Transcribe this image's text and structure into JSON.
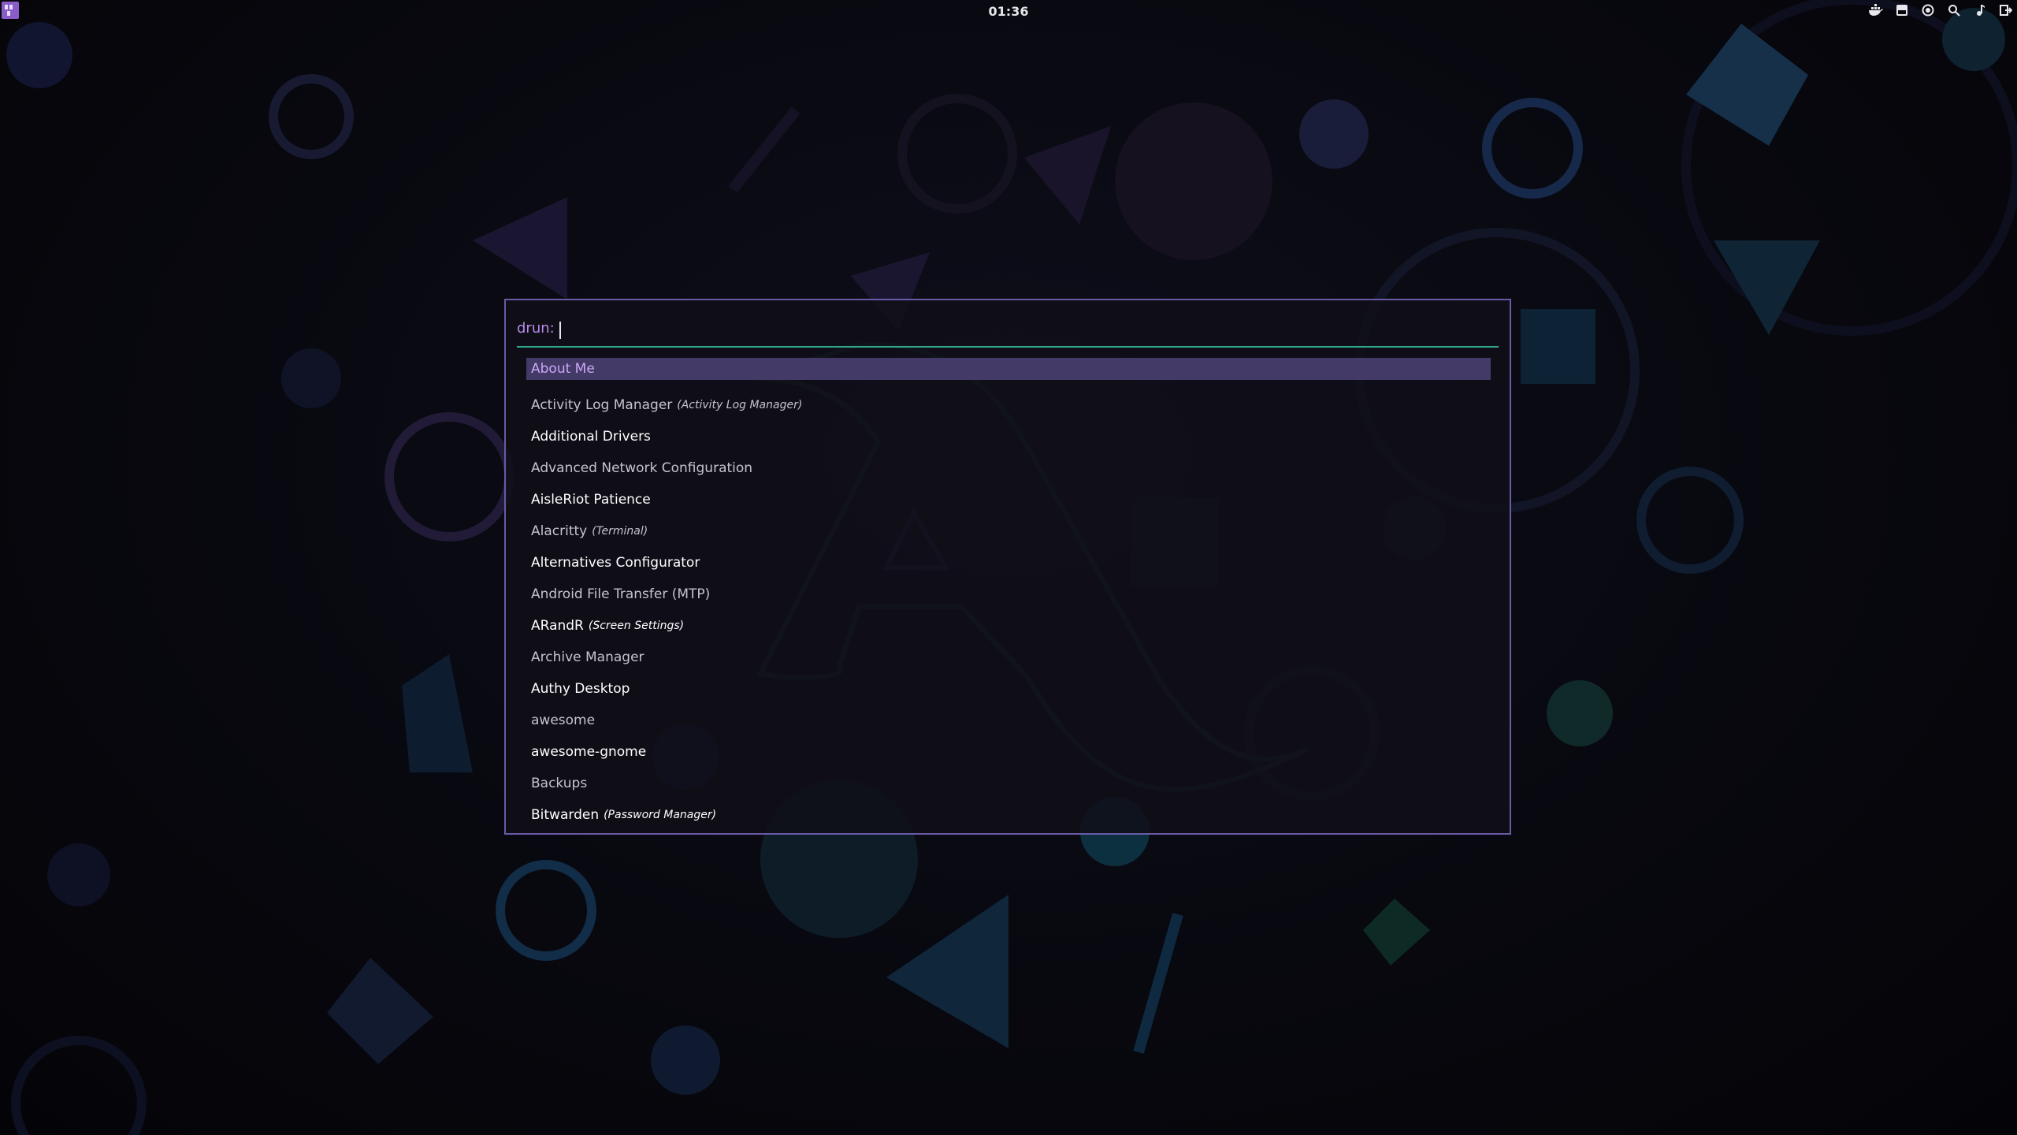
{
  "topbar": {
    "clock": "01:36",
    "launcher_icon": "app-launcher-icon",
    "tray_icons": [
      "docker-icon",
      "window-icon",
      "record-icon",
      "search-icon",
      "music-note-icon",
      "exit-icon"
    ]
  },
  "launcher": {
    "mode_prompt": "drun:",
    "search_value": "",
    "entries": [
      {
        "name": "About Me",
        "generic": "",
        "selected": true
      },
      {
        "name": "Activity Log Manager",
        "generic": "(Activity Log Manager)",
        "selected": false
      },
      {
        "name": "Additional Drivers",
        "generic": "",
        "selected": false
      },
      {
        "name": "Advanced Network Configuration",
        "generic": "",
        "selected": false
      },
      {
        "name": "AisleRiot Patience",
        "generic": "",
        "selected": false
      },
      {
        "name": "Alacritty",
        "generic": "(Terminal)",
        "selected": false
      },
      {
        "name": "Alternatives Configurator",
        "generic": "",
        "selected": false
      },
      {
        "name": "Android File Transfer (MTP)",
        "generic": "",
        "selected": false
      },
      {
        "name": "ARandR",
        "generic": "(Screen Settings)",
        "selected": false
      },
      {
        "name": "Archive Manager",
        "generic": "",
        "selected": false
      },
      {
        "name": "Authy Desktop",
        "generic": "",
        "selected": false
      },
      {
        "name": "awesome",
        "generic": "",
        "selected": false
      },
      {
        "name": "awesome-gnome",
        "generic": "",
        "selected": false
      },
      {
        "name": "Backups",
        "generic": "",
        "selected": false
      },
      {
        "name": "Bitwarden",
        "generic": "(Password Manager)",
        "selected": false
      }
    ]
  },
  "colors": {
    "accent_purple": "#b78ae8",
    "selection_bg": "#443a68",
    "separator_green": "#2fa88a",
    "window_border": "#6a5aa6"
  }
}
